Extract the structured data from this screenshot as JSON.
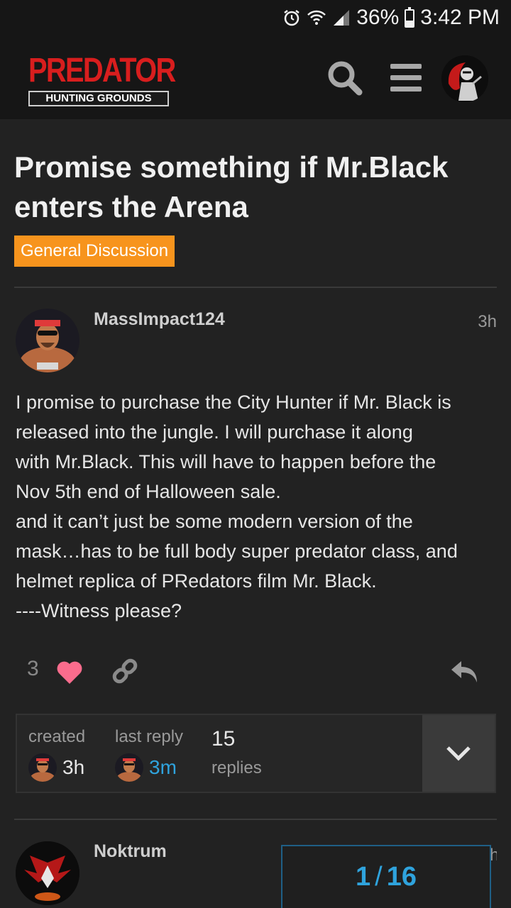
{
  "status_bar": {
    "battery_percent": "36%",
    "battery_level": 0.36,
    "time": "3:42 PM",
    "icons": [
      "alarm-icon",
      "wifi-icon",
      "signal-icon",
      "battery-icon"
    ]
  },
  "header": {
    "logo_title": "PREDATOR",
    "logo_subtitle": "HUNTING GROUNDS",
    "icons": [
      "search-icon",
      "menu-icon",
      "user-avatar"
    ],
    "colors": {
      "logo_red": "#d81e1e",
      "background": "#161616"
    }
  },
  "topic": {
    "title": "Promise something if Mr.Black enters the Arena",
    "category": "General Discussion",
    "category_color": "#f7941d"
  },
  "post": {
    "username": "MassImpact124",
    "time": "3h",
    "body_lines": [
      "I promise to purchase the City Hunter if Mr. Black is",
      "released into the jungle. I will purchase it along",
      "with Mr.Black. This will have to happen before the",
      "Nov 5th end of Halloween sale.",
      "and it can’t just be some modern version of the",
      "mask…has to be full body super predator class, and",
      "helmet replica of PRedators film Mr. Black.",
      "----Witness please?"
    ],
    "like_count": "3",
    "like_color": "#fa6c8d",
    "icons": [
      "heart-icon",
      "link-icon",
      "reply-icon"
    ]
  },
  "topic_map": {
    "created_label": "created",
    "created_value": "3h",
    "last_reply_label": "last reply",
    "last_reply_value": "3m",
    "replies_count": "15",
    "replies_label": "replies",
    "link_color": "#2fa3dd",
    "icons": [
      "chevron-down-icon"
    ]
  },
  "next_post": {
    "username": "Noktrum",
    "time_partial": "h"
  },
  "progress": {
    "current": "1",
    "total": "16"
  }
}
